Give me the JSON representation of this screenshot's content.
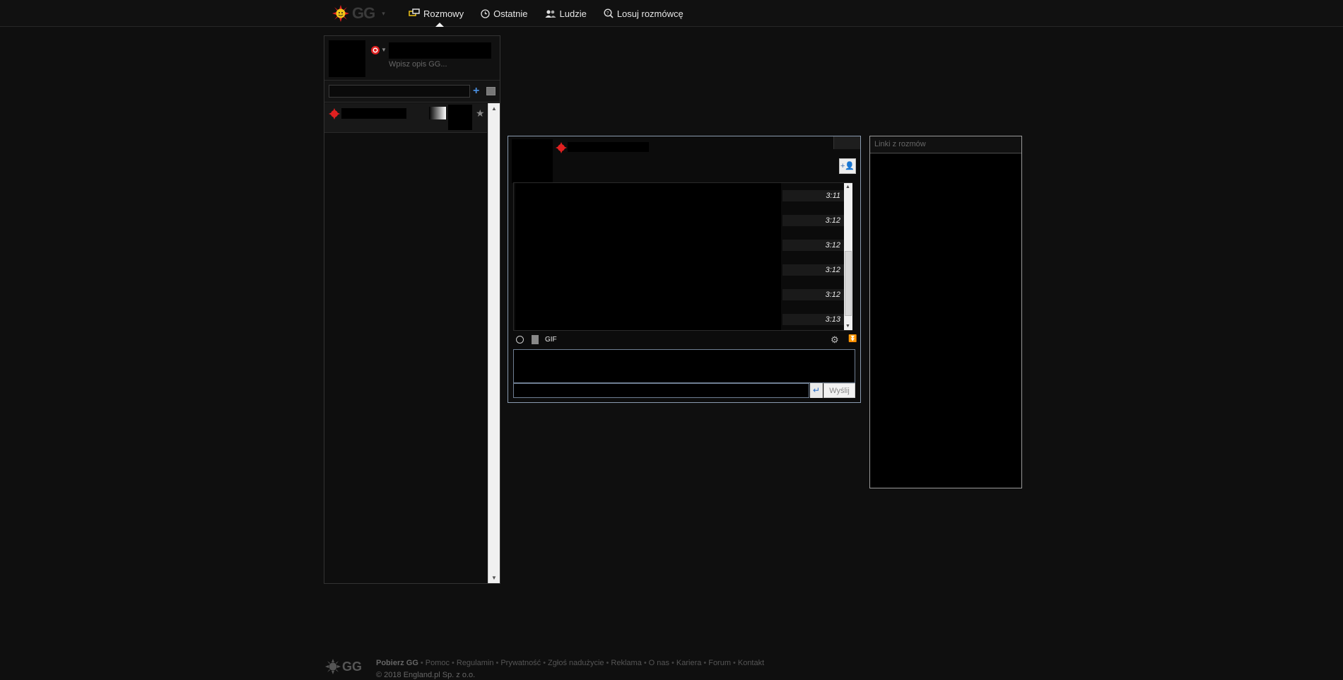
{
  "app": {
    "logo_text": "GG",
    "logo_caret": "▾"
  },
  "nav": [
    {
      "label": "Rozmowy",
      "icon": "chat-bubbles-icon",
      "active": true
    },
    {
      "label": "Ostatnie",
      "icon": "clock-icon",
      "active": false
    },
    {
      "label": "Ludzie",
      "icon": "people-icon",
      "active": false
    },
    {
      "label": "Losuj rozmówcę",
      "icon": "random-search-icon",
      "active": false
    }
  ],
  "profile": {
    "description_placeholder": "Wpisz opis GG..."
  },
  "contacts": {
    "search_placeholder": "",
    "add_symbol": "+",
    "star_symbol": "★"
  },
  "chat": {
    "times": [
      "3:11",
      "3:12",
      "3:12",
      "3:12",
      "3:12",
      "3:13"
    ],
    "toolbar": {
      "gif_label": "GIF",
      "settings_symbol": "⚙",
      "collapse_symbol": "⏬"
    },
    "adduser_symbol": "+👤",
    "enter_symbol": "↵",
    "send_label": "Wyślij"
  },
  "links_panel": {
    "title": "Linki z rozmów"
  },
  "footer": {
    "logo_text": "GG",
    "links": [
      "Pobierz GG",
      "Pomoc",
      "Regulamin",
      "Prywatność",
      "Zgłoś nadużycie",
      "Reklama",
      "O nas",
      "Kariera",
      "Forum",
      "Kontakt"
    ],
    "copyright": "© 2018 England.pl Sp. z o.o."
  },
  "colors": {
    "status_online": "#e02020",
    "sun_yellow": "#f0c419",
    "accent_blue": "#4a8ede"
  }
}
